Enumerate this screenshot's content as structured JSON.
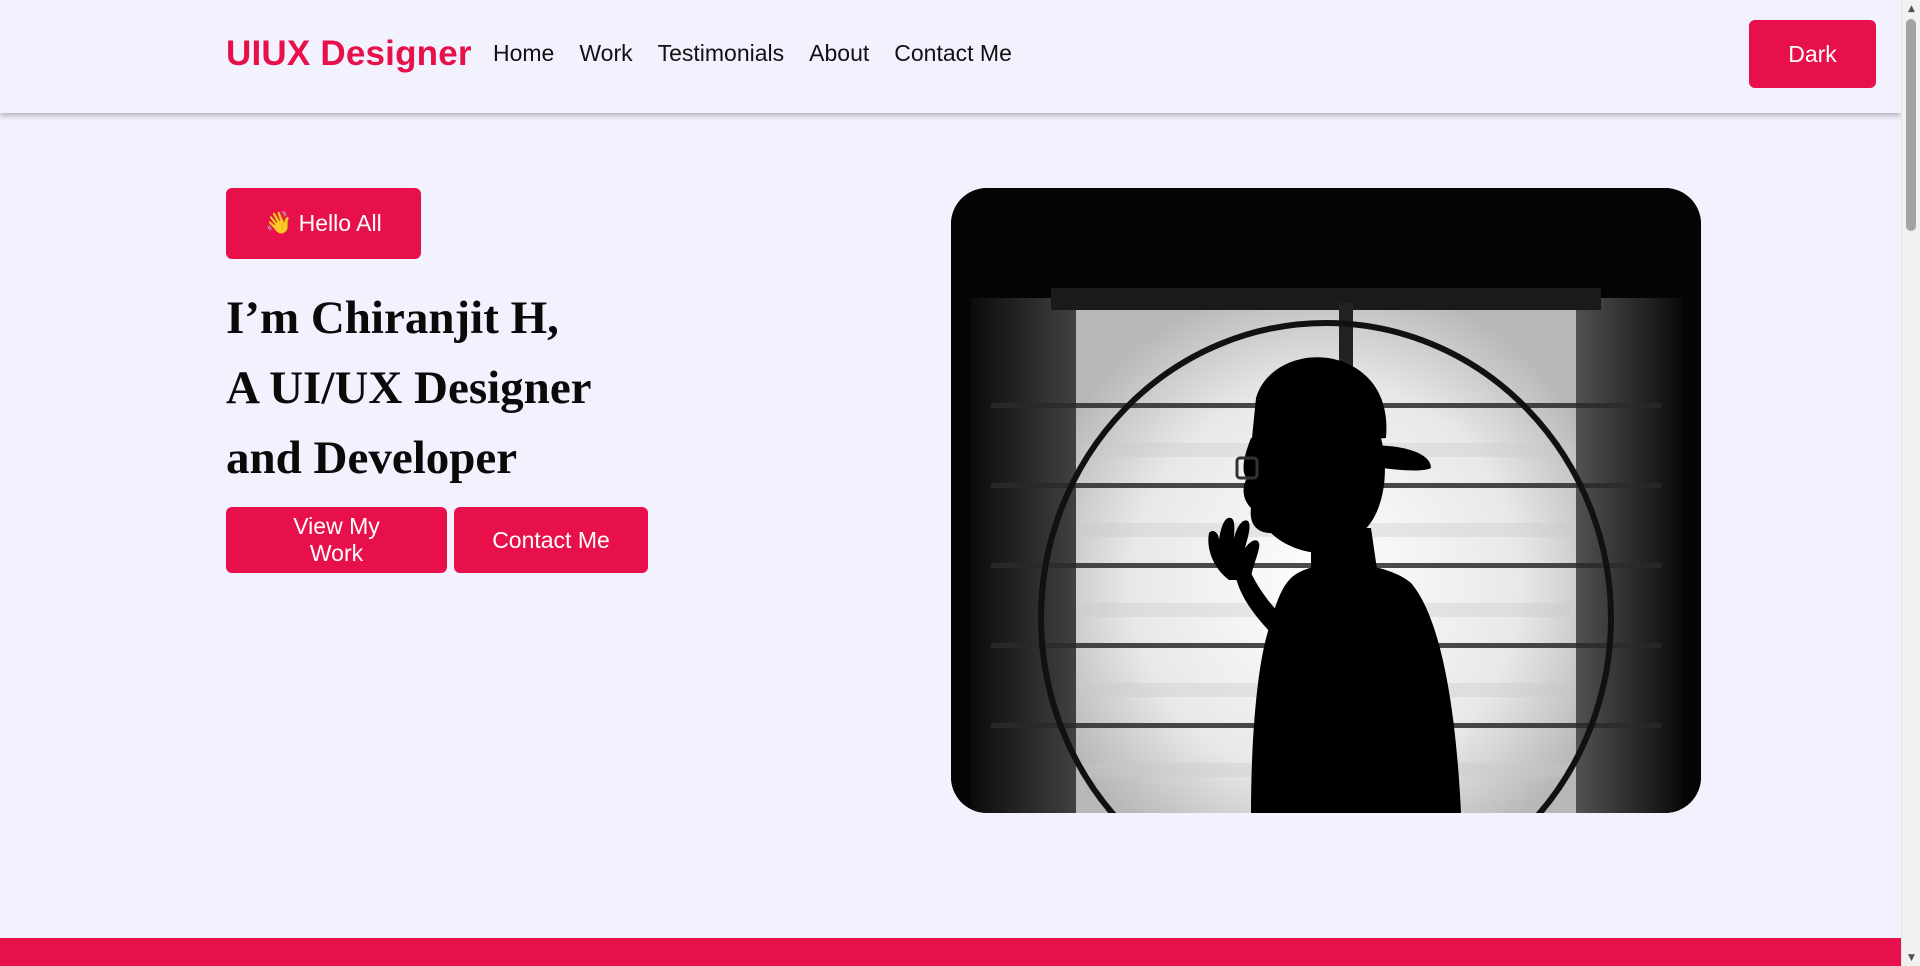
{
  "header": {
    "brand": "UIUX Designer",
    "nav": [
      {
        "label": "Home"
      },
      {
        "label": "Work"
      },
      {
        "label": "Testimonials"
      },
      {
        "label": "About"
      },
      {
        "label": "Contact Me"
      }
    ],
    "theme_toggle_label": "Dark"
  },
  "hero": {
    "greeting_icon": "waving-hand-icon",
    "greeting_emoji": "👋",
    "greeting_label": "Hello All",
    "headline_lines": [
      "I’m Chiranjit H,",
      "A UI/UX Designer",
      "and Developer"
    ],
    "primary_cta": "View My Work",
    "secondary_cta": "Contact Me",
    "image_subject": "silhouette-portrait"
  },
  "colors": {
    "accent": "#e8104a",
    "background": "#f2f1fe",
    "text": "#0a0a0a"
  }
}
